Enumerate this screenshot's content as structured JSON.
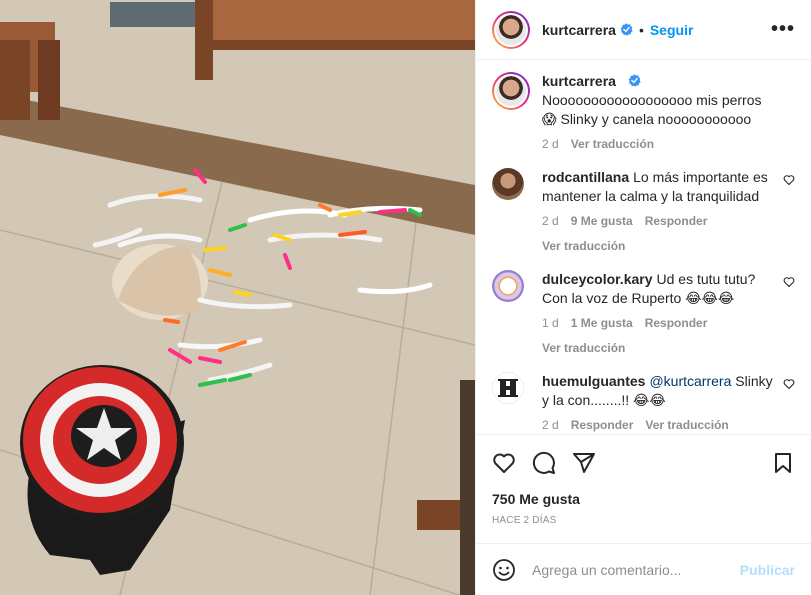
{
  "post": {
    "username": "kurtcarrera",
    "follow_label": "Seguir",
    "separator": "•",
    "more_label": "•••"
  },
  "caption": {
    "username": "kurtcarrera",
    "text": "Noooooooooooooooooo mis perros 😱 Slinky y canela nooooooooooo",
    "age": "2 d",
    "translate": "Ver traducción"
  },
  "comments": [
    {
      "username": "rodcantillana",
      "text": "Lo más importante es mantener la calma y la tranquilidad",
      "age": "2 d",
      "likes": "9 Me gusta",
      "reply": "Responder",
      "translate": "Ver traducción",
      "avatar_color": "#7a5a40"
    },
    {
      "username": "dulceycolor.kary",
      "text": "Ud es tutu tutu? Con la voz de Ruperto 😂😂😂",
      "age": "1 d",
      "likes": "1 Me gusta",
      "reply": "Responder",
      "translate": "Ver traducción",
      "avatar_color": "#e8e0f0"
    },
    {
      "username": "huemulguantes",
      "mention": "@kurtcarrera",
      "text": " Slinky y la con........!! 😂😂",
      "age": "2 d",
      "reply": "Responder",
      "translate": "Ver traducción",
      "avatar_color": "#ffffff"
    }
  ],
  "stats": {
    "likes": "750 Me gusta",
    "date": "HACE 2 DÍAS"
  },
  "add_comment": {
    "placeholder": "Agrega un comentario...",
    "publish_label": "Publicar"
  },
  "colors": {
    "accent": "#0095f6",
    "verified": "#3897f0",
    "publish_disabled": "#b2dffc",
    "muted": "#8e8e8e"
  }
}
